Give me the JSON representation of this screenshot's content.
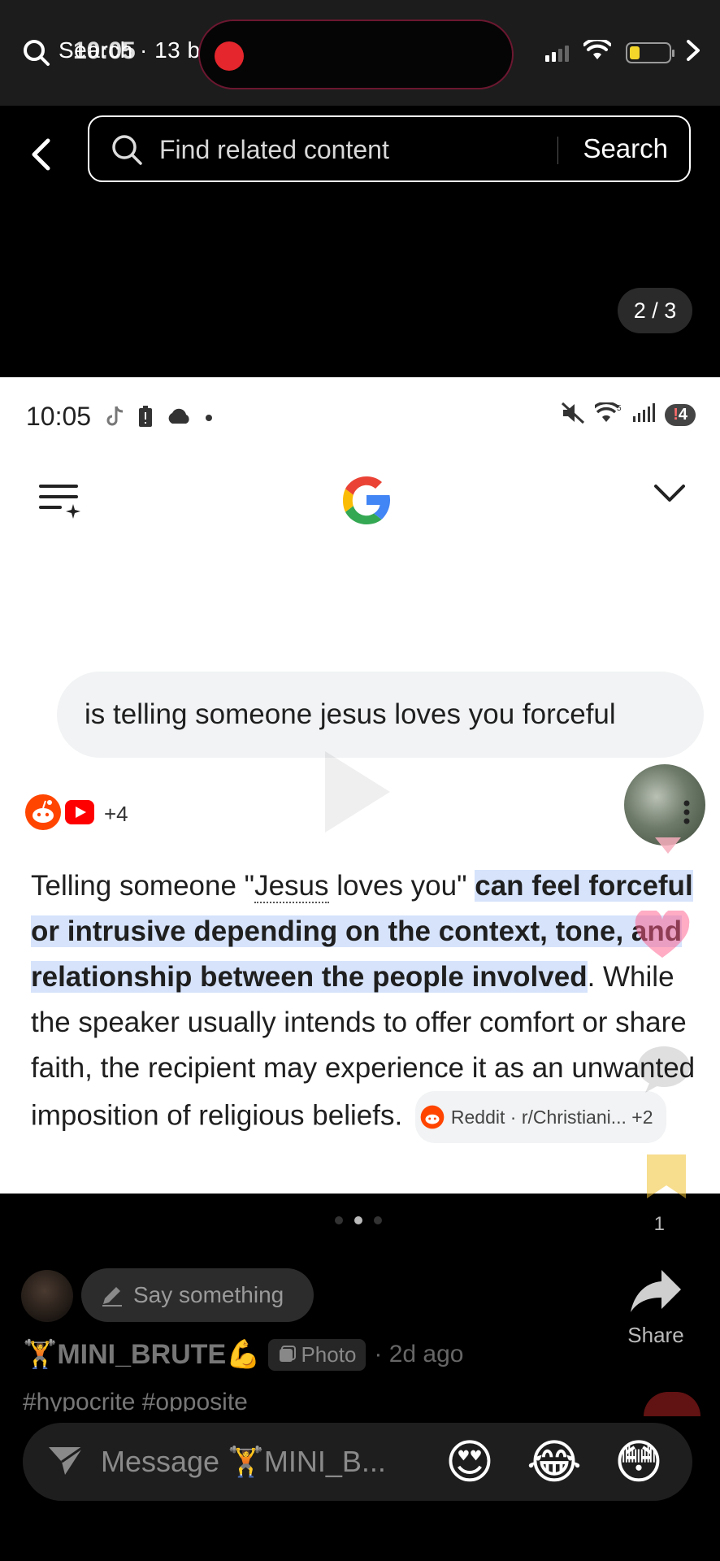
{
  "status_bar": {
    "left_text": "Search · 13 b",
    "time": "10:05"
  },
  "top_search": {
    "placeholder": "Find related content",
    "search_label": "Search",
    "page_counter": "2 / 3"
  },
  "inner_screenshot": {
    "time": "10:05",
    "signal_label": "5",
    "notification_count": "4",
    "query": "is telling someone jesus loves you forceful",
    "sources_more": "+4",
    "answer": {
      "part1": "Telling someone \"",
      "dotted": "Jesus",
      "part2": " loves you\" ",
      "highlight": "can feel forceful or intrusive depending on the context, tone, and relationship between the people involved",
      "part3": ". While the speaker usually intends to offer comfort or share faith, the recipient may experience it as an unwanted imposition of religious beliefs. ",
      "chip_label": "Reddit · r/Christiani... +2"
    }
  },
  "bottom": {
    "bookmark_count": "1",
    "say_placeholder": "Say something",
    "share_label": "Share",
    "username": "🏋️MINI_BRUTE💪",
    "post_type": "Photo",
    "post_time": "· 2d ago",
    "hashtags": "#hypocrite #opposite",
    "message_placeholder": "Message 🏋️MINI_B...",
    "emojis": [
      "😍",
      "😂",
      "😳"
    ]
  },
  "colors": {
    "highlight": "#d6e3fb",
    "record_red": "#e5262d",
    "battery_yellow": "#f4d62b"
  }
}
